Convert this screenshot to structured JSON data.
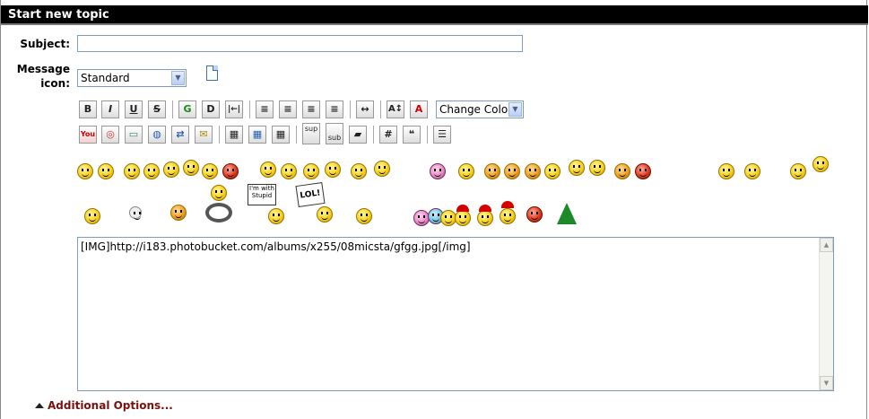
{
  "title": "Start new topic",
  "subject": {
    "label": "Subject:",
    "value": ""
  },
  "message_icon": {
    "label_line1": "Message",
    "label_line2": "icon:",
    "selected": "Standard",
    "arrow": "chevron-down-icon"
  },
  "toolbar": {
    "bold": "B",
    "italic": "I",
    "underline": "U",
    "strike": "S",
    "glow": "G",
    "shadow": "D",
    "pre": "|←|",
    "align_left": "left",
    "align_center": "center",
    "align_middle": "middle",
    "align_right": "right",
    "hr": "↔",
    "size": "A↕",
    "font_color": "A",
    "color_select": "Change Color",
    "youtube": "You",
    "sup": "sup",
    "sub": "sub",
    "hash": "#"
  },
  "message": {
    "value": "[IMG]http://i183.photobucket.com/albums/x255/08micsta/gfgg.jpg[/img]"
  },
  "additional_options": "Additional Options...",
  "signs": {
    "stupid": "I'm with Stupid",
    "lol": "LOL!"
  }
}
